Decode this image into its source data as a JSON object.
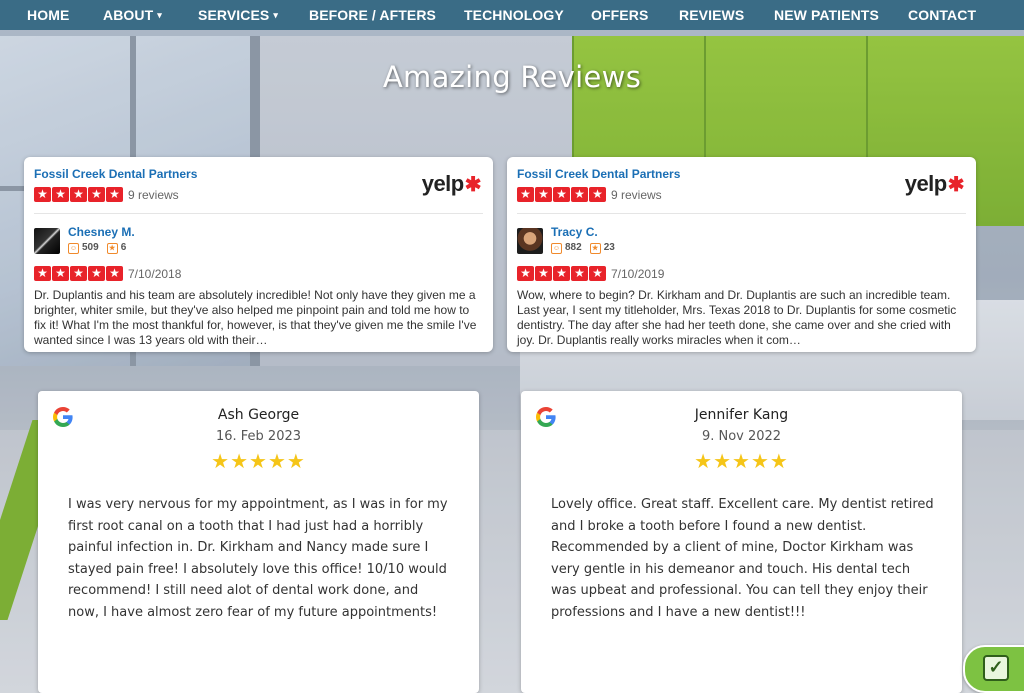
{
  "nav": {
    "items": [
      {
        "label": "HOME"
      },
      {
        "label": "ABOUT",
        "caret": "▾"
      },
      {
        "label": "SERVICES",
        "caret": "▾"
      },
      {
        "label": "BEFORE / AFTERS"
      },
      {
        "label": "TECHNOLOGY"
      },
      {
        "label": "OFFERS"
      },
      {
        "label": "REVIEWS"
      },
      {
        "label": "NEW PATIENTS"
      },
      {
        "label": "CONTACT"
      }
    ],
    "bg_color": "#3a6c86"
  },
  "section_title": "Amazing Reviews",
  "yelp_reviews": [
    {
      "business": "Fossil Creek Dental Partners",
      "business_rating": 5,
      "review_count": "9 reviews",
      "logo_text": "yelp",
      "reviewer": "Chesney M.",
      "friends": "509",
      "reviews": "6",
      "rating": 5,
      "date": "7/10/2018",
      "text": "Dr. Duplantis and his team are absolutely incredible! Not only have they given me a brighter, whiter smile, but they've also helped me pinpoint pain and told me how to fix it! What I'm the most thankful for, however, is that they've given me the smile I've wanted since I was 13 years old with their…"
    },
    {
      "business": "Fossil Creek Dental Partners",
      "business_rating": 5,
      "review_count": "9 reviews",
      "logo_text": "yelp",
      "reviewer": "Tracy C.",
      "friends": "882",
      "reviews": "23",
      "rating": 5,
      "date": "7/10/2019",
      "text": "Wow, where to begin? Dr. Kirkham and Dr. Duplantis are such an incredible team. Last year, I sent my titleholder, Mrs. Texas 2018 to Dr. Duplantis for some cosmetic dentistry. The day after she had her teeth done, she came over and she cried with joy. Dr. Duplantis really works miracles when it com…"
    }
  ],
  "google_reviews": [
    {
      "name": "Ash George",
      "date": "16. Feb 2023",
      "stars": "★★★★★",
      "text": "I was very nervous for my appointment, as I was in for my first root canal on a tooth that I had just had a horribly painful infection in. Dr. Kirkham and Nancy made sure I stayed pain free! I absolutely love this office! 10/10 would recommend! I still need alot of dental work done, and now, I have almost zero fear of my future appointments!"
    },
    {
      "name": "Jennifer Kang",
      "date": "9. Nov 2022",
      "stars": "★★★★★",
      "text": "Lovely office. Great staff. Excellent care. My dentist retired and I broke a tooth before I found a new dentist. Recommended by a client of mine, Doctor Kirkham was very gentle in his demeanor and touch. His dental tech was upbeat and professional. You can tell they enjoy their professions and I have a new dentist!!!"
    }
  ],
  "colors": {
    "yelp_red": "#e8232a",
    "link_blue": "#1b6fb5",
    "google_star": "#f5c518",
    "badge_green": "#7dc242"
  },
  "icons": {
    "yelp_stat_friends": "friends-icon",
    "yelp_stat_reviews": "review-star-icon",
    "google": "google-g-icon",
    "badge": "verified-check-icon"
  }
}
